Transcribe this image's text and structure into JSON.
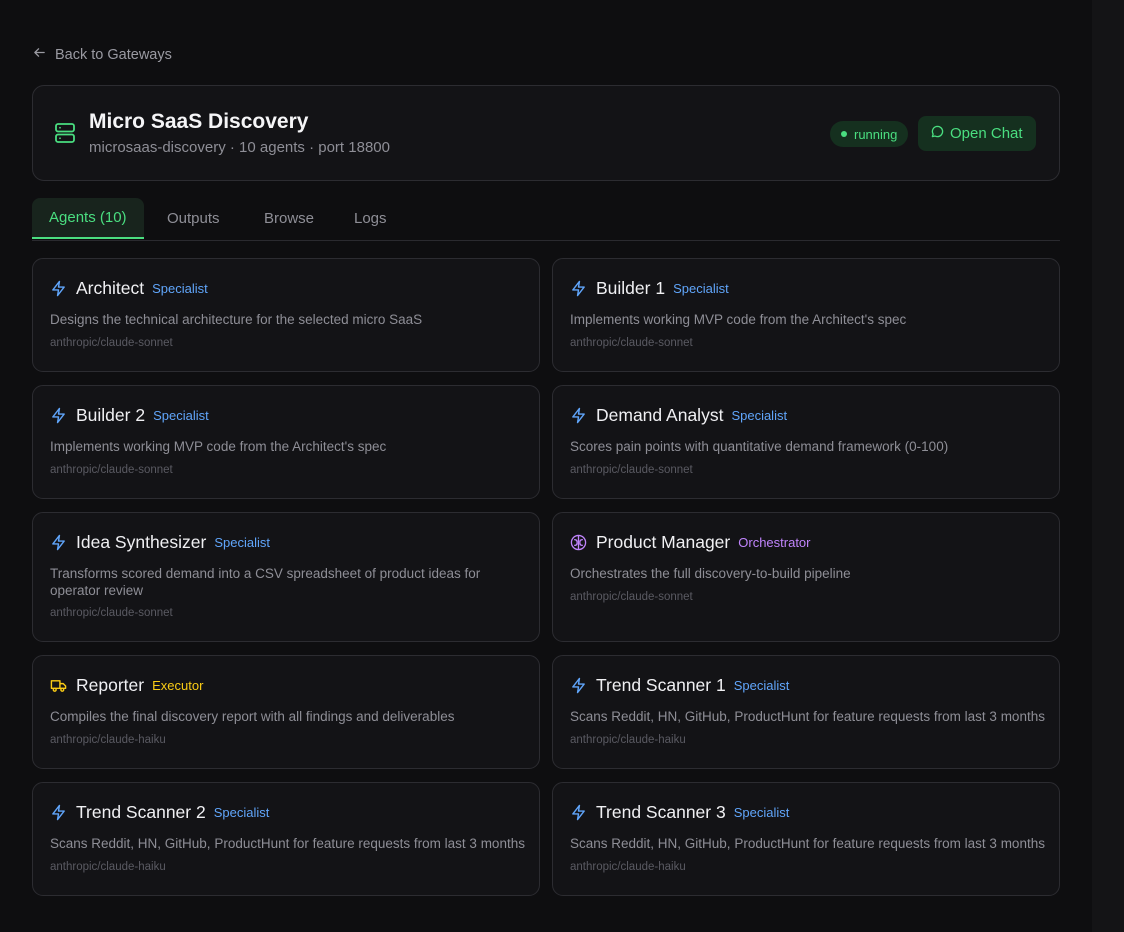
{
  "nav": {
    "back_label": "Back to Gateways"
  },
  "gateway": {
    "name": "Micro SaaS Discovery",
    "subtitle": "microsaas-discovery · 10 agents · port 18800",
    "status": "running",
    "open_chat_label": "Open Chat"
  },
  "tabs": [
    {
      "label": "Agents (10)",
      "active": true
    },
    {
      "label": "Outputs",
      "active": false
    },
    {
      "label": "Browse",
      "active": false
    },
    {
      "label": "Logs",
      "active": false
    }
  ],
  "agents": [
    {
      "name": "Architect",
      "role": "Specialist",
      "icon": "lightning-icon",
      "description": "Designs the technical architecture for the selected micro SaaS",
      "model": "anthropic/claude-sonnet"
    },
    {
      "name": "Builder 1",
      "role": "Specialist",
      "icon": "lightning-icon",
      "description": "Implements working MVP code from the Architect's spec",
      "model": "anthropic/claude-sonnet"
    },
    {
      "name": "Builder 2",
      "role": "Specialist",
      "icon": "lightning-icon",
      "description": "Implements working MVP code from the Architect's spec",
      "model": "anthropic/claude-sonnet"
    },
    {
      "name": "Demand Analyst",
      "role": "Specialist",
      "icon": "lightning-icon",
      "description": "Scores pain points with quantitative demand framework (0-100)",
      "model": "anthropic/claude-sonnet"
    },
    {
      "name": "Idea Synthesizer",
      "role": "Specialist",
      "icon": "lightning-icon",
      "description": "Transforms scored demand into a CSV spreadsheet of product ideas for operator review",
      "model": "anthropic/claude-sonnet"
    },
    {
      "name": "Product Manager",
      "role": "Orchestrator",
      "icon": "brain-icon",
      "description": "Orchestrates the full discovery-to-build pipeline",
      "model": "anthropic/claude-sonnet"
    },
    {
      "name": "Reporter",
      "role": "Executor",
      "icon": "truck-icon",
      "description": "Compiles the final discovery report with all findings and deliverables",
      "model": "anthropic/claude-haiku"
    },
    {
      "name": "Trend Scanner 1",
      "role": "Specialist",
      "icon": "lightning-icon",
      "description": "Scans Reddit, HN, GitHub, ProductHunt for feature requests from last 3 months",
      "model": "anthropic/claude-haiku"
    },
    {
      "name": "Trend Scanner 2",
      "role": "Specialist",
      "icon": "lightning-icon",
      "description": "Scans Reddit, HN, GitHub, ProductHunt for feature requests from last 3 months",
      "model": "anthropic/claude-haiku"
    },
    {
      "name": "Trend Scanner 3",
      "role": "Specialist",
      "icon": "lightning-icon",
      "description": "Scans Reddit, HN, GitHub, ProductHunt for feature requests from last 3 months",
      "model": "anthropic/claude-haiku"
    }
  ],
  "colors": {
    "accent_green": "#4ade80",
    "specialist": "#60a5fa",
    "orchestrator": "#c084fc",
    "executor": "#facc15"
  }
}
